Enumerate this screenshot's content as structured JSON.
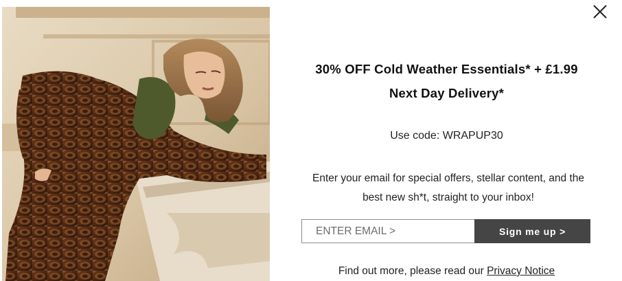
{
  "modal": {
    "close_icon": "close-icon",
    "image": "model-in-snakeskin-dress-photo",
    "headline_line1": "30% OFF Cold Weather Essentials* + £1.99",
    "headline_line2": "Next Day Delivery*",
    "code_text": "Use code: WRAPUP30",
    "body_line1": "Enter your email for special offers, stellar content, and the",
    "body_line2": "best new sh*t, straight to your inbox!",
    "email_placeholder": "ENTER EMAIL >",
    "signup_label": "Sign me up >",
    "footer_prefix": "Find out more, please read our ",
    "privacy_link": "Privacy Notice"
  },
  "colors": {
    "button_bg": "#454545",
    "button_text": "#ffffff",
    "text": "#222222",
    "border": "#8a8a8a"
  }
}
